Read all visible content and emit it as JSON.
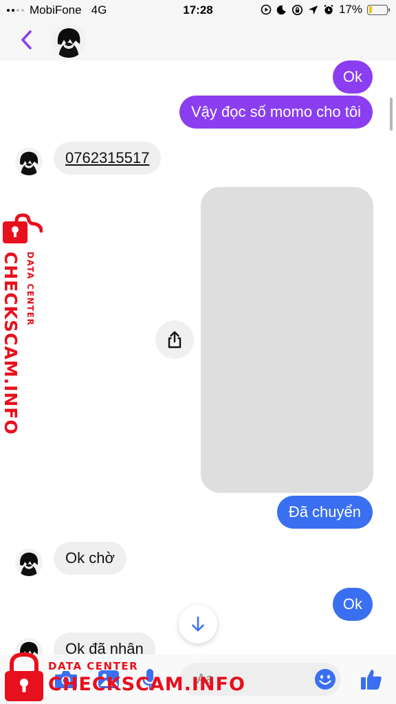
{
  "status_bar": {
    "carrier": "MobiFone",
    "network": "4G",
    "time": "17:28",
    "battery_percent": "17%",
    "battery_level": 0.17,
    "icons": [
      "screen-record-icon",
      "do-not-disturb-icon",
      "rotation-lock-icon",
      "location-icon",
      "alarm-icon",
      "battery-charging-icon"
    ]
  },
  "header": {
    "back_icon": "chevron-left-icon",
    "accent_color": "#8a3ef0"
  },
  "messages": [
    {
      "direction": "outgoing",
      "text": "Ok",
      "color": "#8a3ef0"
    },
    {
      "direction": "outgoing",
      "text": "Vậy đọc số momo cho tôi",
      "color": "#8a3ef0"
    },
    {
      "direction": "incoming",
      "text": "0762315517",
      "link": true
    },
    {
      "direction": "outgoing",
      "type": "image"
    },
    {
      "direction": "outgoing",
      "text": "Đã chuyển",
      "color": "#3a6ff2"
    },
    {
      "direction": "incoming",
      "text": "Ok chờ"
    },
    {
      "direction": "outgoing",
      "text": "Ok",
      "color": "#3a6ff2"
    },
    {
      "direction": "incoming",
      "text": "Ok đã nhận"
    }
  ],
  "composer": {
    "placeholder": "Aa",
    "icons": [
      "camera-icon",
      "photo-icon",
      "microphone-icon",
      "emoji-icon",
      "thumbs-up-icon"
    ],
    "accent_color": "#3a6ff2"
  },
  "watermark": {
    "brand": "CHECKSCAM.INFO",
    "subtitle": "DATA CENTER",
    "color": "#e8101c"
  }
}
